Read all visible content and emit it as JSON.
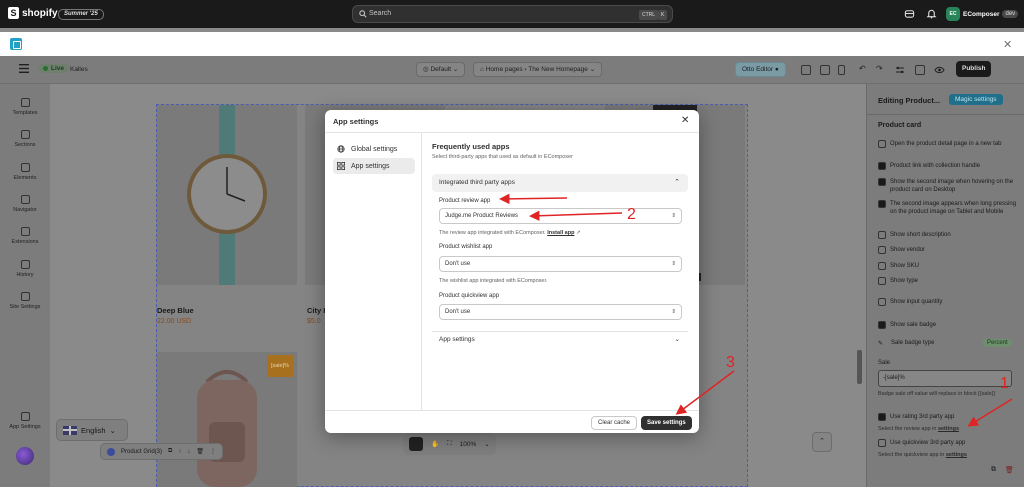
{
  "shopify": {
    "brand": "shopify",
    "edition": "Summer '25",
    "search_placeholder": "Search",
    "kbd1": "CTRL",
    "kbd2": "K",
    "account_initials": "EC",
    "account_name": "EComposer",
    "account_tag": "dev"
  },
  "editor": {
    "live": "Live",
    "theme": "Kalles",
    "device": "Default",
    "page_breadcrumb": "Home pages",
    "page_name": "The New Homepage",
    "otto": "Otto Editor",
    "publish": "Publish"
  },
  "rail": [
    {
      "label": "Templates",
      "icon": "templates-icon"
    },
    {
      "label": "Sections",
      "icon": "sections-icon"
    },
    {
      "label": "Elements",
      "icon": "elements-icon"
    },
    {
      "label": "Navigator",
      "icon": "navigator-icon"
    },
    {
      "label": "Extensions",
      "icon": "extensions-icon"
    },
    {
      "label": "History",
      "icon": "history-icon"
    },
    {
      "label": "Site Settings",
      "icon": "site-settings-icon"
    },
    {
      "label": "App Settings",
      "icon": "app-settings-icon"
    }
  ],
  "canvas": {
    "p1_name": "Deep Blue",
    "p1_price": "22.00 USD",
    "p2_name": "City I",
    "p2_price": "$5.0",
    "sale_badge": "[sale]%",
    "language": "English",
    "grid_tool": "Product Grid(3)",
    "zoom": "100%"
  },
  "right_panel": {
    "title": "Editing Product...",
    "magic": "Magic settings",
    "section": "Product card",
    "options": [
      {
        "label": "Open the product detail page in a new tab",
        "checked": false
      },
      {
        "label": "Product link with collection handle",
        "checked": true
      },
      {
        "label": "Show the second image when hovering on the product card on Desktop",
        "checked": true
      },
      {
        "label": "The second image appears when long pressing on the product image on Tablet and Mobile",
        "checked": true
      },
      {
        "label": "Show short description",
        "checked": false
      },
      {
        "label": "Show vendor",
        "checked": false
      },
      {
        "label": "Show SKU",
        "checked": false
      },
      {
        "label": "Show type",
        "checked": false
      },
      {
        "label": "Show input quantity",
        "checked": false
      },
      {
        "label": "Show sale badge",
        "checked": true
      }
    ],
    "badge_type_label": "Sale badge type",
    "badge_type_value": "Percent",
    "sale_label": "Sale",
    "sale_value": "-[sale]%",
    "sale_help": "Badge sale off value will replace in block [{sale}]",
    "rating_label": "Use rating 3rd party app",
    "rating_help": "Select the review app in",
    "rating_help_link": "settings",
    "quickview_label": "Use quickview 3rd party app",
    "quickview_help": "Select the quickview app in",
    "quickview_help_link": "settings"
  },
  "modal": {
    "title": "App settings",
    "nav": [
      {
        "label": "Global settings",
        "icon": "globe-icon"
      },
      {
        "label": "App settings",
        "icon": "apps-icon"
      }
    ],
    "heading": "Frequently used apps",
    "subheading": "Select third-party apps that used as default in EComposer",
    "integrated": "Integrated third party apps",
    "review_label": "Product review app",
    "review_value": "Judge.me Product Reviews",
    "review_help": "The review app integrated with EComposer.",
    "review_help_link": "Install app",
    "wishlist_label": "Product wishlist app",
    "wishlist_value": "Don't use",
    "wishlist_help": "The wishlist app integrated with EComposer.",
    "quickview_label": "Product quickview app",
    "quickview_value": "Don't use",
    "app_settings_row": "App settings",
    "clear_cache": "Clear cache",
    "save": "Save settings"
  },
  "annotations": {
    "n1": "1",
    "n2": "2",
    "n3": "3",
    "color": "#e02424"
  }
}
